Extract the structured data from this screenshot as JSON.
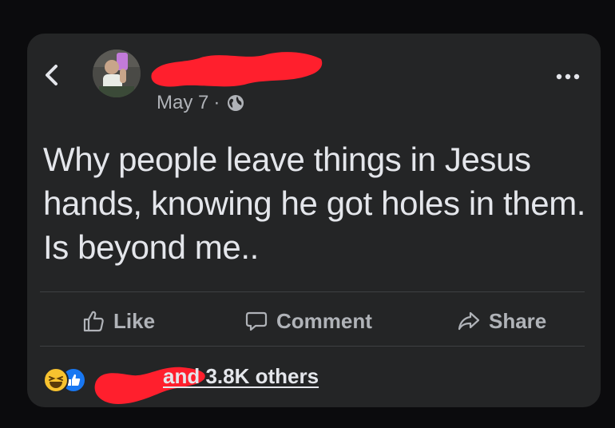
{
  "post": {
    "date": "May 7",
    "separator": "·",
    "privacy_icon": "globe-icon",
    "text": "Why people leave things in Jesus hands, knowing he got holes in them. Is beyond me..",
    "author_redacted": true
  },
  "actions": {
    "like_label": "Like",
    "comment_label": "Comment",
    "share_label": "Share"
  },
  "reactions": {
    "icons": [
      "haha-icon",
      "like-icon"
    ],
    "summary": "and 3.8K others"
  },
  "colors": {
    "background": "#0b0b0d",
    "card": "#242526",
    "text_primary": "#e4e6eb",
    "text_secondary": "#b0b3b8",
    "redaction": "#ff1f2d",
    "like_blue": "#1877f2",
    "haha_yellow": "#f7c22f"
  }
}
